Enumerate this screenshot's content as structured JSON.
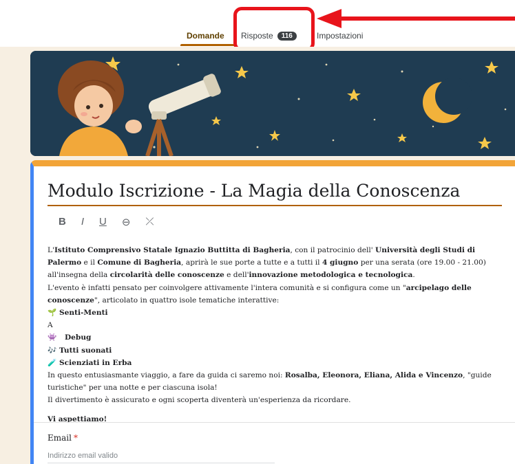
{
  "tabs": {
    "domande": "Domande",
    "risposte": "Risposte",
    "risposte_count": "116",
    "impostazioni": "Impostazioni"
  },
  "form": {
    "title": "Modulo Iscrizione - La Magia della Conoscenza",
    "formatting": {
      "bold": "B",
      "italic": "I",
      "underline": "U",
      "link": "⊖",
      "clear": "⤫"
    },
    "description": {
      "p1": [
        "L'",
        "Istituto Comprensivo Statale Ignazio Buttitta di Bagheria",
        ", con il patrocinio dell' ",
        "Università degli Studi di Palermo",
        " e il ",
        "Comune di Bagheria",
        ", aprirà le sue porte a tutte e a tutti il ",
        "4 giugno",
        " per una serata (ore 19.00 - 21.00) all'insegna della ",
        "circolarità delle conoscenze",
        " e dell'",
        "innovazione metodologica e tecnologica",
        "."
      ],
      "p2": [
        "L'evento è infatti pensato per coinvolgere attivamente l'intera comunità e si configura come un \"",
        "arcipelago delle conoscenze",
        "\", articolato in quattro isole tematiche interattive:"
      ],
      "islands": [
        {
          "icon": "🌱",
          "label": "Senti-Menti"
        },
        {
          "icon": "A👾",
          "label": "Debug"
        },
        {
          "icon": "🎶",
          "label": "Tutti suonati"
        },
        {
          "icon": "🧪",
          "label": "Scienziati in Erba"
        }
      ],
      "p3": [
        "In questo entusiasmante viaggio, a fare da guida ci saremo noi: ",
        "Rosalba, Eleonora, Eliana, Alida e Vincenzo",
        ", \"guide turistiche\" per una notte e per ciascuna isola!"
      ],
      "p4": "Il divertimento è assicurato e ogni scoperta diventerà un'esperienza da ricordare.",
      "closing": "Vi aspettiamo!"
    },
    "email": {
      "label": "Email",
      "required_mark": "*",
      "placeholder": "Indirizzo email valido"
    }
  },
  "colors": {
    "accent": "#f2a438",
    "highlight_box": "#e8141b",
    "banner_bg": "#1f3c52",
    "left_bar": "#4285f4",
    "page_bg": "#f7efe2"
  }
}
